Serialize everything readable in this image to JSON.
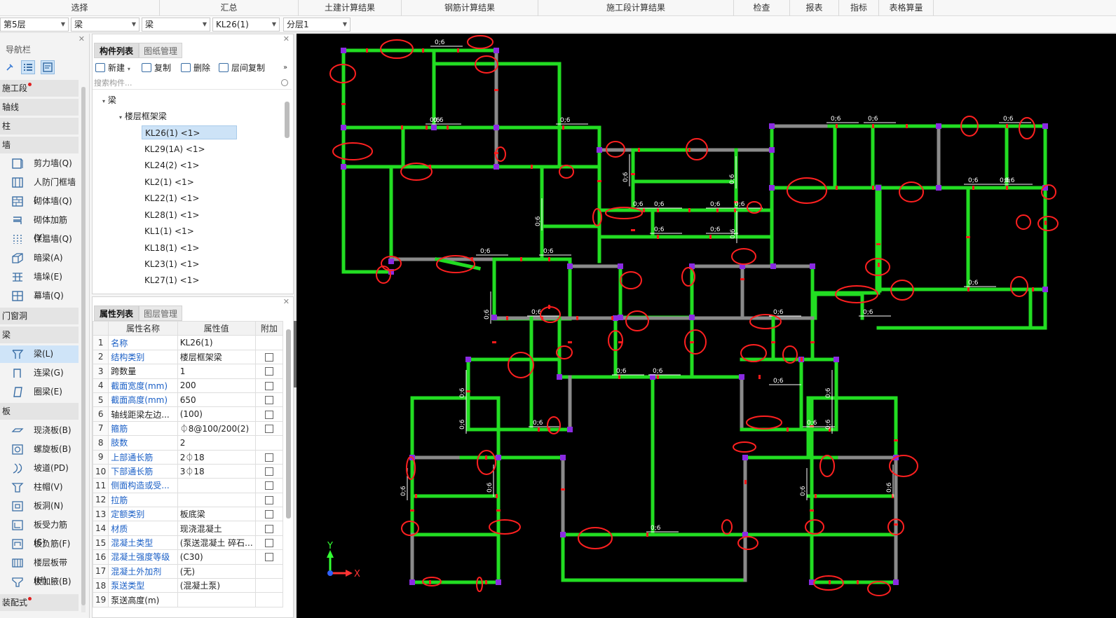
{
  "top_tabs": [
    "选择",
    "汇总",
    "土建计算结果",
    "钢筋计算结果",
    "施工段计算结果",
    "检查",
    "报表",
    "指标",
    "表格算量"
  ],
  "selectors": {
    "floor": "第5层",
    "category": "梁",
    "type": "梁",
    "component": "KL26(1)",
    "layer": "分层1"
  },
  "nav": {
    "title": "导航栏",
    "categories": {
      "construction_segment": "施工段",
      "axis": "轴线",
      "column": "柱",
      "wall": "墙",
      "door_window": "门窗洞",
      "beam": "梁",
      "slab": "板",
      "prefab": "装配式"
    },
    "wall_items": [
      "剪力墙(Q)",
      "人防门框墙(",
      "砌体墙(Q)",
      "砌体加筋(Y)",
      "保温墙(Q)",
      "暗梁(A)",
      "墙垛(E)",
      "幕墙(Q)"
    ],
    "beam_items": [
      "梁(L)",
      "连梁(G)",
      "圈梁(E)"
    ],
    "slab_items": [
      "现浇板(B)",
      "螺旋板(B)",
      "坡道(PD)",
      "柱帽(V)",
      "板洞(N)",
      "板受力筋(S)",
      "板负筋(F)",
      "楼层板带(H)",
      "板加腋(B)"
    ]
  },
  "component_list": {
    "tab_active": "构件列表",
    "tab_other": "图纸管理",
    "tools": {
      "new": "新建",
      "copy": "复制",
      "delete": "删除",
      "floor_copy": "层间复制"
    },
    "search_placeholder": "搜索构件...",
    "tree_root": "梁",
    "tree_group": "楼层框架梁",
    "items": [
      "KL26(1) <1>",
      "KL29(1A) <1>",
      "KL24(2) <1>",
      "KL2(1) <1>",
      "KL22(1) <1>",
      "KL28(1) <1>",
      "KL1(1) <1>",
      "KL18(1) <1>",
      "KL23(1) <1>",
      "KL27(1) <1>"
    ],
    "selected_index": 0
  },
  "properties": {
    "tab_active": "属性列表",
    "tab_other": "图层管理",
    "headers": {
      "name": "属性名称",
      "value": "属性值",
      "extra": "附加"
    },
    "rows": [
      {
        "no": "1",
        "name": "名称",
        "value": "KL26(1)",
        "checkbox": false,
        "blue": true
      },
      {
        "no": "2",
        "name": "结构类别",
        "value": "楼层框架梁",
        "checkbox": true,
        "blue": true
      },
      {
        "no": "3",
        "name": "跨数量",
        "value": "1",
        "checkbox": true,
        "blue": false
      },
      {
        "no": "4",
        "name": "截面宽度(mm)",
        "value": "200",
        "checkbox": true,
        "blue": true
      },
      {
        "no": "5",
        "name": "截面高度(mm)",
        "value": "650",
        "checkbox": true,
        "blue": true
      },
      {
        "no": "6",
        "name": "轴线距梁左边...",
        "value": "(100)",
        "checkbox": true,
        "blue": false
      },
      {
        "no": "7",
        "name": "箍筋",
        "value": "⏀8@100/200(2)",
        "checkbox": true,
        "blue": true
      },
      {
        "no": "8",
        "name": "肢数",
        "value": "2",
        "checkbox": false,
        "blue": true
      },
      {
        "no": "9",
        "name": "上部通长筋",
        "value": "2⏀18",
        "checkbox": true,
        "blue": true
      },
      {
        "no": "10",
        "name": "下部通长筋",
        "value": "3⏀18",
        "checkbox": true,
        "blue": true
      },
      {
        "no": "11",
        "name": "侧面构造或受...",
        "value": "",
        "checkbox": true,
        "blue": true
      },
      {
        "no": "12",
        "name": "拉筋",
        "value": "",
        "checkbox": true,
        "blue": true
      },
      {
        "no": "13",
        "name": "定额类别",
        "value": "板底梁",
        "checkbox": true,
        "blue": true
      },
      {
        "no": "14",
        "name": "材质",
        "value": "现浇混凝土",
        "checkbox": true,
        "blue": true
      },
      {
        "no": "15",
        "name": "混凝土类型",
        "value": "(泵送混凝土 碎石...",
        "checkbox": true,
        "blue": true
      },
      {
        "no": "16",
        "name": "混凝土强度等级",
        "value": "(C30)",
        "checkbox": true,
        "blue": true
      },
      {
        "no": "17",
        "name": "混凝土外加剂",
        "value": "(无)",
        "checkbox": false,
        "blue": true
      },
      {
        "no": "18",
        "name": "泵送类型",
        "value": "(混凝土泵)",
        "checkbox": false,
        "blue": true
      },
      {
        "no": "19",
        "name": "泵送高度(m)",
        "value": "",
        "checkbox": false,
        "blue": false
      }
    ]
  },
  "canvas": {
    "beam_tag": "0;6",
    "axis_x": "X",
    "axis_y": "Y",
    "colors": {
      "background": "#000000",
      "beam": "#22dd22",
      "gray_beam": "#8a8a8a",
      "node": "#8a2be2",
      "marker": "#ff1a1a",
      "ellipse": "#ff2020"
    }
  }
}
